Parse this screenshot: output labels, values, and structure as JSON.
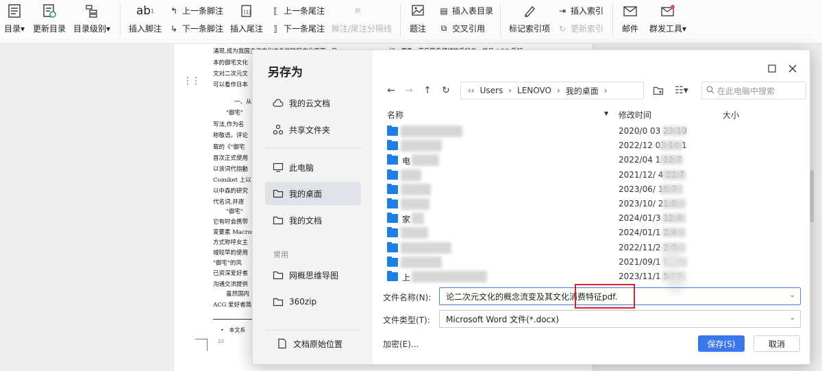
{
  "ribbon": {
    "toc": "目录",
    "update_toc": "更新目录",
    "toc_level": "目录级别",
    "insert_footnote": "插入脚注",
    "prev_footnote": "上一条脚注",
    "next_footnote": "下一条脚注",
    "insert_endnote": "插入尾注",
    "prev_endnote": "上一条尾注",
    "next_endnote": "下一条尾注",
    "note_separator": "脚注/尾注分隔线",
    "caption": "题注",
    "insert_table_of_figures": "插入表目录",
    "cross_reference": "交叉引用",
    "mark_index_entry": "标记索引项",
    "insert_index": "插入索引",
    "update_index": "更新索引",
    "mail": "邮件",
    "mass_tools": "群发工具",
    "footnote_glyph": "ab",
    "footnote_sup": "1"
  },
  "document": {
    "lines": [
      "涌现,成为我国主流文化之外的独特文化景观。且",
      "本的御宅文化",
      "文对二次元文",
      "可以看作日本",
      "一、从",
      "\"御宅\"",
      "写法,作为名",
      "称敬语。评论",
      "载的《\"御宅",
      "首次正式使用",
      "以该词代指動",
      "Comiket 上以",
      "以中森的研究",
      "代名词,并逐",
      "\"御宅\"",
      "它有时会携带",
      "变要素 Macros",
      "方式称呼女主",
      "域较早的使用",
      "\"御宅\"的风",
      "已资深爱好者",
      "沟通交流提供",
      "虽然国内",
      "ACG 爱好者简"
    ],
    "line_right": "幻、偶像、音乐等各领域的爱好者。并且,ACG 爱好",
    "footnote": "本文系",
    "page_num": "22"
  },
  "dialog": {
    "title": "另存为",
    "sidebar": {
      "items": [
        "我的云文档",
        "共享文件夹",
        "此电脑",
        "我的桌面",
        "我的文档"
      ],
      "section_common": "常用",
      "common_items": [
        "网概思维导图",
        "360zip"
      ],
      "doc_location": "文档原始位置"
    },
    "path": [
      "Users",
      "LENOVO",
      "我的桌面"
    ],
    "search_placeholder": "在此电脑中搜索",
    "columns": {
      "name": "名称",
      "modified": "修改时间",
      "size": "大小"
    },
    "files": [
      {
        "name": "",
        "date": "2020/0 03 23:10"
      },
      {
        "name": "",
        "date": "2022/12 03 14:1"
      },
      {
        "name": "电",
        "date": "2022/04 1 12:7"
      },
      {
        "name": "",
        "date": "2021/12/ 4 22:7"
      },
      {
        "name": "",
        "date": "2023/06/ 16:7"
      },
      {
        "name": "",
        "date": "2023/10/ 21:8"
      },
      {
        "name": "家",
        "date": "2024/01/3 12:4"
      },
      {
        "name": "",
        "date": "2024/01/1 2:4"
      },
      {
        "name": "",
        "date": "2022/11/2 2:0"
      },
      {
        "name": "",
        "date": "2021/09/1 9:"
      },
      {
        "name": "上",
        "date": "2023/11/1 5:03"
      }
    ],
    "filename_label": "文件名称(N):",
    "filename_value": "论二次元文化的概念流变及其文化消费特征pdf.",
    "filetype_label": "文件类型(T):",
    "filetype_value": "Microsoft Word 文件(*.docx)",
    "encrypt": "加密(E)...",
    "save": "保存(S)",
    "cancel": "取消"
  },
  "colors": {
    "accent": "#3a77ea",
    "folder": "#1d7ee3",
    "highlight": "#e02020"
  }
}
